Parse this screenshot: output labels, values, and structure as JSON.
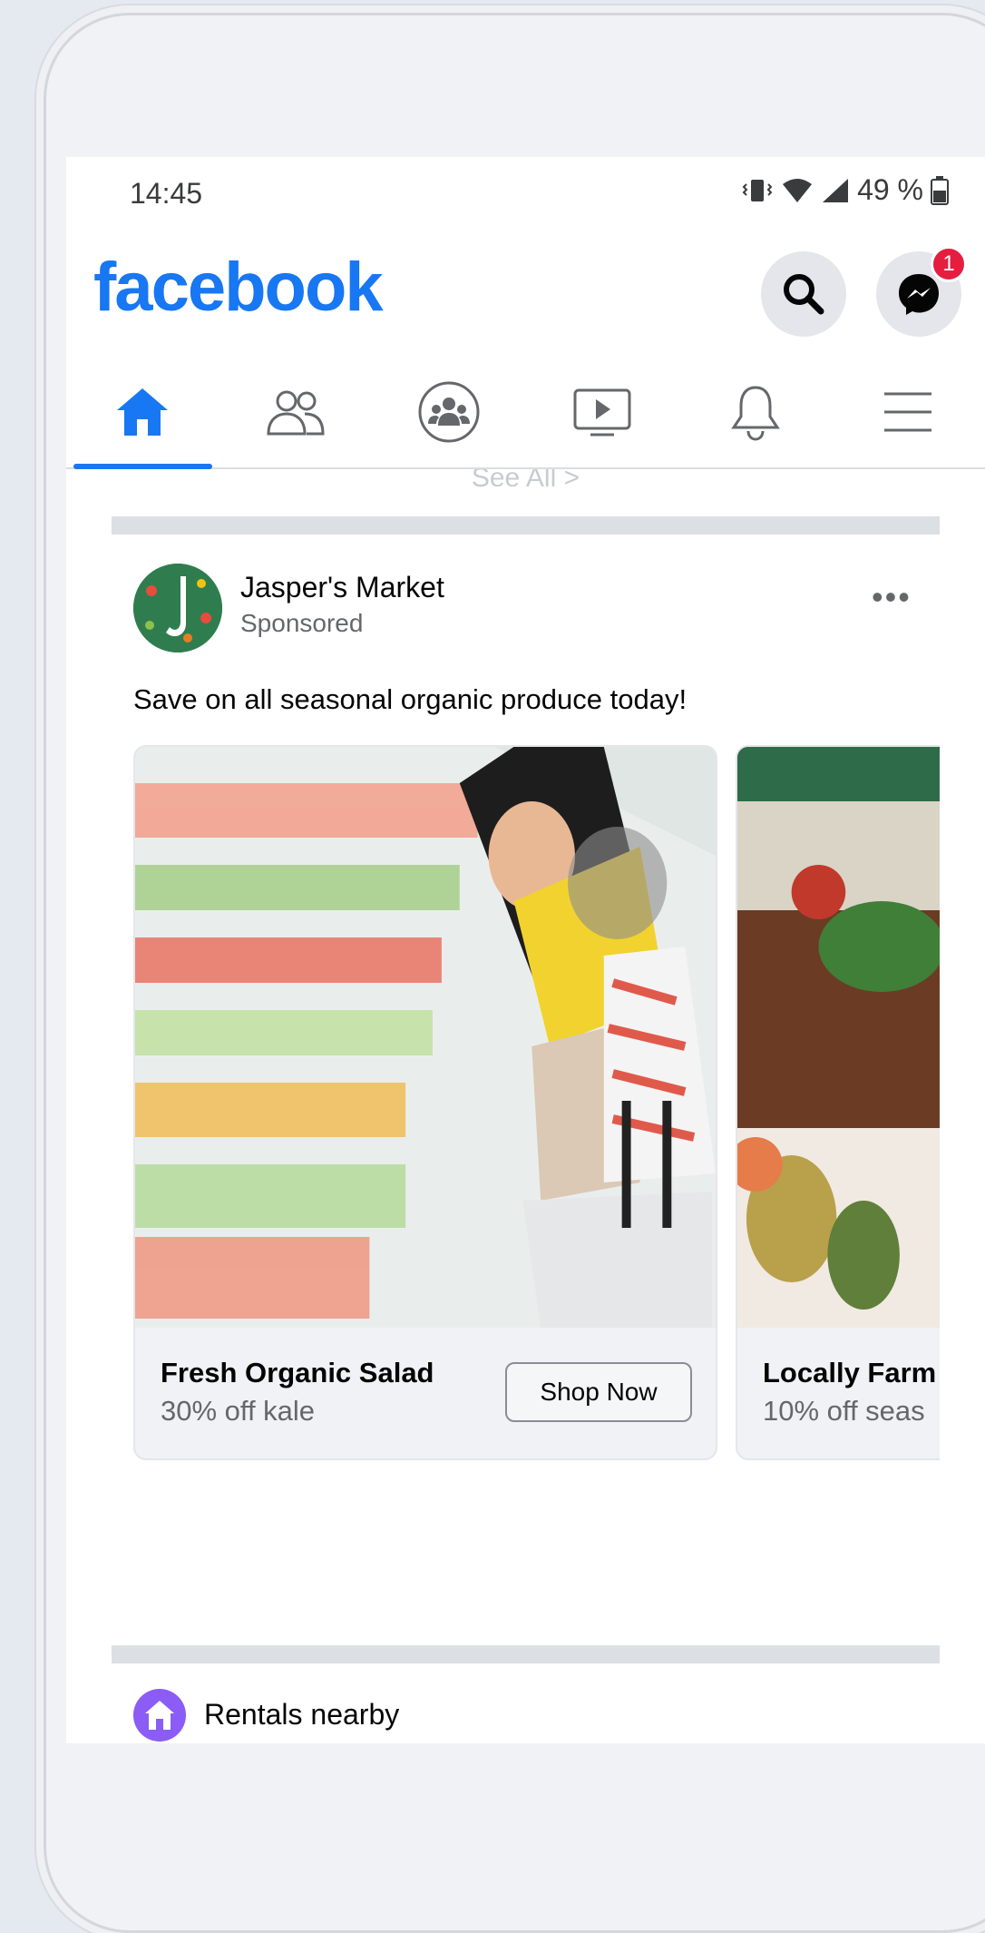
{
  "status_bar": {
    "time": "14:45",
    "battery": "49 %"
  },
  "header": {
    "logo": "facebook",
    "messenger_badge": "1"
  },
  "tabs": [
    {
      "name": "home-icon",
      "active": true
    },
    {
      "name": "friends-icon",
      "active": false
    },
    {
      "name": "groups-icon",
      "active": false
    },
    {
      "name": "watch-icon",
      "active": false
    },
    {
      "name": "notifications-icon",
      "active": false
    },
    {
      "name": "menu-icon",
      "active": false
    }
  ],
  "feed": {
    "see_all": "See All >",
    "post": {
      "author": "Jasper's Market",
      "sponsored": "Sponsored",
      "more": "•••",
      "text": "Save on all seasonal organic produce today!",
      "cards": [
        {
          "title": "Fresh Organic Salad",
          "subtitle": "30% off kale",
          "button": "Shop Now"
        },
        {
          "title": "Locally Farm",
          "subtitle": "10% off seas"
        }
      ]
    },
    "rentals": {
      "title": "Rentals nearby"
    }
  },
  "colors": {
    "brand": "#1877f2",
    "badge": "#e41e3f",
    "divider": "#dcdfe3"
  }
}
